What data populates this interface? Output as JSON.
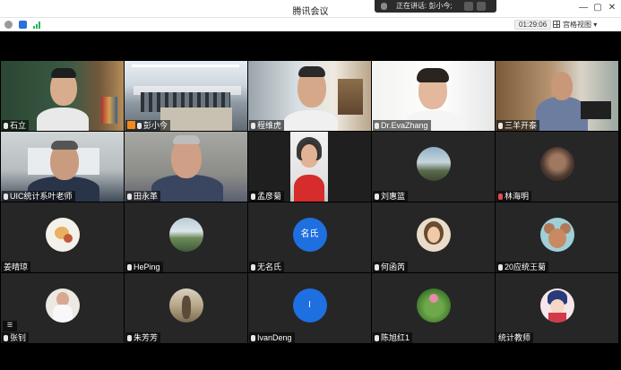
{
  "window": {
    "title": "腾讯会议",
    "speaking_text": "正在讲话: 彭小今;",
    "controls": [
      "—",
      "▢",
      "✕"
    ]
  },
  "toolbar": {
    "timer": "01:29:06",
    "view_label": "宫格视图"
  },
  "colors": {
    "active_border": "#c8a46a",
    "avatar_blue": "#1e6fe0",
    "muted_mic": "#e84a4a",
    "tile_bg": "#262626"
  },
  "participants": [
    {
      "name": "石立",
      "mic": "on",
      "video": "green",
      "active": true
    },
    {
      "name": "彭小今",
      "mic": "speaking",
      "video": "classroom"
    },
    {
      "name": "程维虎",
      "mic": "on",
      "video": "office"
    },
    {
      "name": "Dr.EvaZhang",
      "mic": "on",
      "video": "white"
    },
    {
      "name": "三羊开泰",
      "mic": "on",
      "video": "bookshelf"
    },
    {
      "name": "UIC统计系叶老师",
      "mic": "on",
      "video": "room"
    },
    {
      "name": "田永革",
      "mic": "on",
      "video": "wall"
    },
    {
      "name": "孟彦菊",
      "mic": "on",
      "video": "phone"
    },
    {
      "name": "刘惠篮",
      "mic": "on",
      "avatar": "landscape"
    },
    {
      "name": "林海明",
      "mic": "muted",
      "avatar": "profile"
    },
    {
      "name": "姜晴琼",
      "mic": "none",
      "avatar": "cartoon"
    },
    {
      "name": "HePing",
      "mic": "on",
      "avatar": "mountain"
    },
    {
      "name": "无名氏",
      "mic": "on",
      "avatar": "blue",
      "avatar_text": "名氏"
    },
    {
      "name": "何函芮",
      "mic": "on",
      "avatar": "girl"
    },
    {
      "name": "20应统王菊",
      "mic": "on",
      "avatar": "cartoon-mouse"
    },
    {
      "name": "张钊",
      "mic": "on",
      "avatar": "person-white"
    },
    {
      "name": "朱芳芳",
      "mic": "on",
      "avatar": "bird"
    },
    {
      "name": "IvanDeng",
      "mic": "on",
      "avatar": "blue",
      "avatar_text": "I"
    },
    {
      "name": "陈旭红1",
      "mic": "on",
      "avatar": "lotus"
    },
    {
      "name": "统计教师",
      "mic": "none",
      "avatar": "anime"
    }
  ]
}
